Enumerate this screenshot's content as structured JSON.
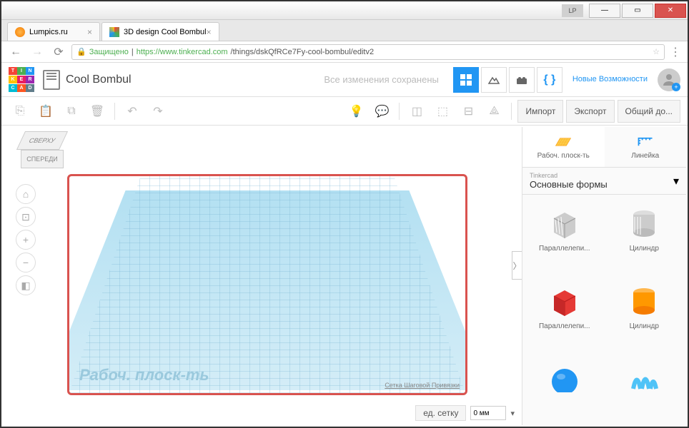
{
  "window": {
    "lp": "LP",
    "min": "—",
    "max": "▭",
    "close": "✕"
  },
  "tabs": {
    "items": [
      {
        "title": "Lumpics.ru"
      },
      {
        "title": "3D design Cool Bombul"
      }
    ]
  },
  "address": {
    "secure": "Защищено",
    "host": "https://www.tinkercad.com",
    "path": "/things/dskQfRCe7Fy-cool-bombul/editv2"
  },
  "header": {
    "project": "Cool Bombul",
    "status": "Все изменения сохранены",
    "features": "Новые Возможности",
    "logo": [
      "T",
      "I",
      "N",
      "K",
      "E",
      "R",
      "C",
      "A",
      "D"
    ]
  },
  "toolbar": {
    "import": "Импорт",
    "export": "Экспорт",
    "share": "Общий до..."
  },
  "viewcube": {
    "top": "СВЕРХУ",
    "front": "СПЕРЕДИ"
  },
  "canvas": {
    "label": "Рабоч. плоск-ть",
    "snap": "Сетка Шаговой Привязки",
    "grid_btn": "ед. сетку",
    "mm": "0 мм"
  },
  "sidebar": {
    "workplane": "Рабоч. плоск-ть",
    "ruler": "Линейка",
    "cat_label": "Tinkercad",
    "cat_value": "Основные формы",
    "shapes": [
      {
        "name": "Параллелепи..."
      },
      {
        "name": "Цилиндр"
      },
      {
        "name": "Параллелепи..."
      },
      {
        "name": "Цилиндр"
      }
    ]
  }
}
